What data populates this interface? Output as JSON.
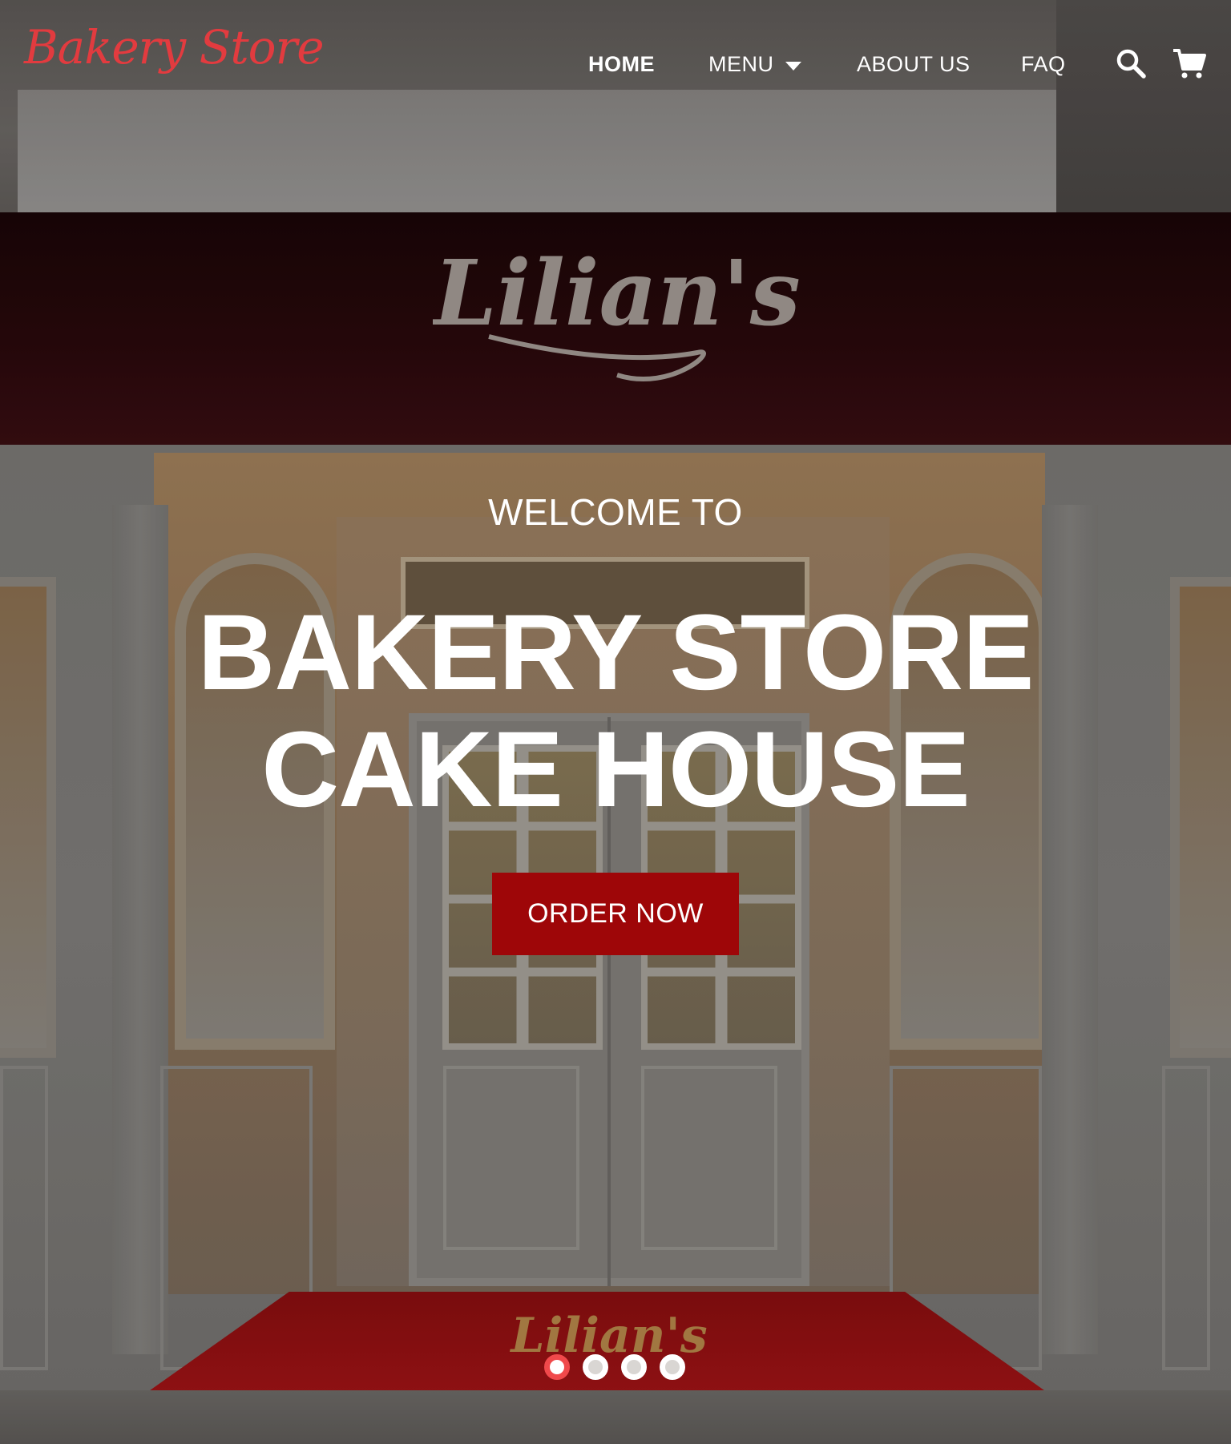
{
  "brand": {
    "logo_text": "Bakery Store",
    "logo_color": "#e23b3f"
  },
  "nav": {
    "items": [
      {
        "label": "HOME",
        "active": true
      },
      {
        "label": "MENU",
        "has_dropdown": true,
        "icon": "caret-down-icon"
      },
      {
        "label": "ABOUT US"
      },
      {
        "label": "FAQ"
      }
    ],
    "search_icon": "search-icon",
    "cart_icon": "cart-icon"
  },
  "hero": {
    "eyebrow": "WELCOME TO",
    "title": "BAKERY STORE CAKE HOUSE",
    "cta_label": "ORDER NOW",
    "cta_color": "#9e0608",
    "background_signage": "Lilian's"
  },
  "carousel": {
    "slide_count": 4,
    "active_index": 0,
    "active_color": "#f0494b"
  }
}
